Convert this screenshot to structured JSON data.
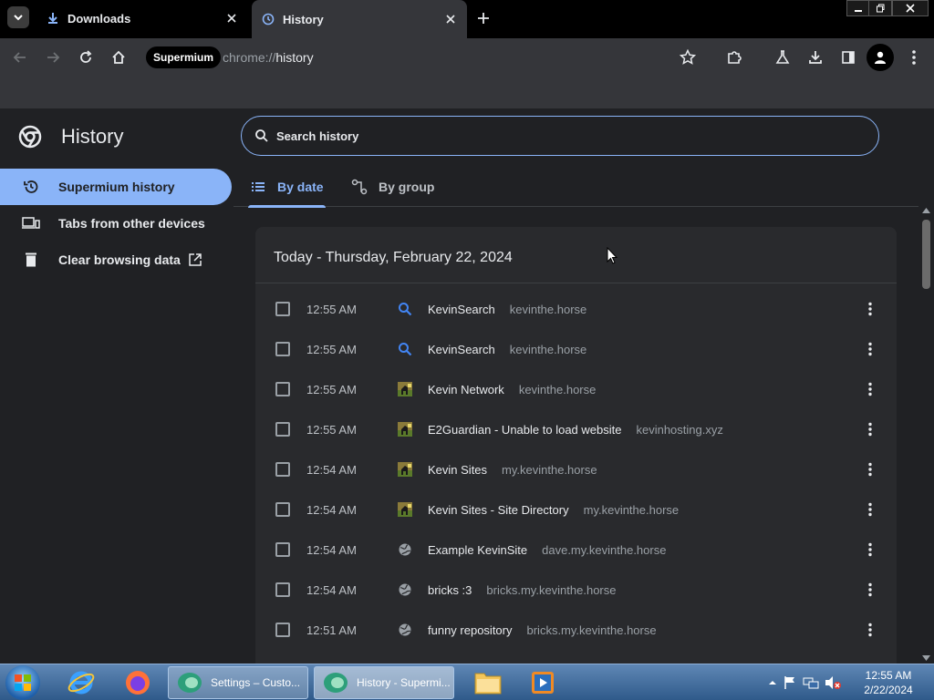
{
  "browser": {
    "tabs": [
      {
        "title": "Downloads",
        "icon": "download-icon",
        "active": false
      },
      {
        "title": "History",
        "icon": "history-icon",
        "active": true
      }
    ],
    "address": {
      "chip": "Supermium",
      "scheme": "chrome://",
      "host": "history"
    }
  },
  "page": {
    "title": "History",
    "search_placeholder": "Search history",
    "nav": [
      {
        "label": "Supermium history",
        "icon": "history-icon",
        "selected": true
      },
      {
        "label": "Tabs from other devices",
        "icon": "devices-icon",
        "selected": false
      },
      {
        "label": "Clear browsing data",
        "icon": "trash-icon",
        "selected": false
      }
    ],
    "view_tabs": [
      {
        "label": "By date",
        "icon": "list-icon",
        "active": true
      },
      {
        "label": "By group",
        "icon": "group-icon",
        "active": false
      }
    ],
    "day_header": "Today - Thursday, February 22, 2024",
    "entries": [
      {
        "time": "12:55 AM",
        "title": "KevinSearch",
        "domain": "kevinthe.horse",
        "icon": "search-icon"
      },
      {
        "time": "12:55 AM",
        "title": "KevinSearch",
        "domain": "kevinthe.horse",
        "icon": "search-icon"
      },
      {
        "time": "12:55 AM",
        "title": "Kevin Network",
        "domain": "kevinthe.horse",
        "icon": "horse-favicon"
      },
      {
        "time": "12:55 AM",
        "title": "E2Guardian - Unable to load website",
        "domain": "kevinhosting.xyz",
        "icon": "horse-favicon"
      },
      {
        "time": "12:54 AM",
        "title": "Kevin Sites",
        "domain": "my.kevinthe.horse",
        "icon": "horse-favicon"
      },
      {
        "time": "12:54 AM",
        "title": "Kevin Sites - Site Directory",
        "domain": "my.kevinthe.horse",
        "icon": "horse-favicon"
      },
      {
        "time": "12:54 AM",
        "title": "Example KevinSite",
        "domain": "dave.my.kevinthe.horse",
        "icon": "globe-icon"
      },
      {
        "time": "12:54 AM",
        "title": "bricks :3",
        "domain": "bricks.my.kevinthe.horse",
        "icon": "globe-icon"
      },
      {
        "time": "12:51 AM",
        "title": "funny repository",
        "domain": "bricks.my.kevinthe.horse",
        "icon": "globe-icon"
      }
    ]
  },
  "taskbar": {
    "tasks": [
      {
        "label": "Settings – Custo...",
        "active": false
      },
      {
        "label": "History - Supermi...",
        "active": true
      }
    ],
    "clock_time": "12:55 AM",
    "clock_date": "2/22/2024"
  },
  "colors": {
    "accent": "#8ab4f8",
    "background": "#202124",
    "card": "#292a2d"
  }
}
